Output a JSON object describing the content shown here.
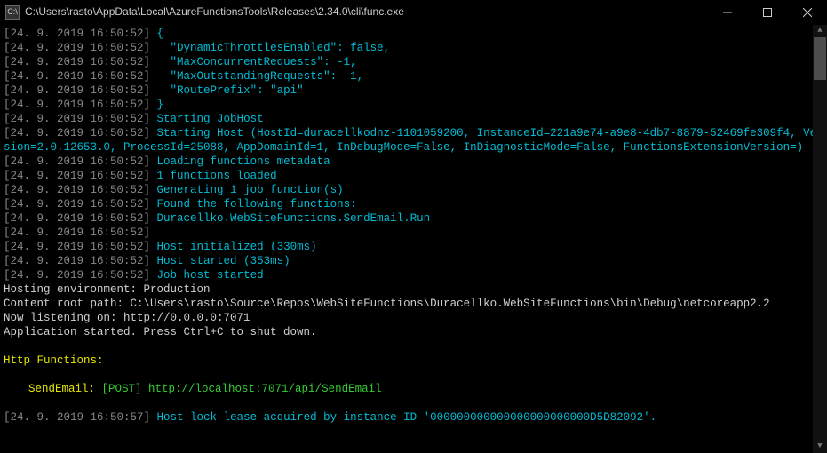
{
  "window": {
    "title": "C:\\Users\\rasto\\AppData\\Local\\AzureFunctionsTools\\Releases\\2.34.0\\cli\\func.exe",
    "icon_text": "C:\\"
  },
  "timestamps": {
    "t1": "[24. 9. 2019 16:50:52]",
    "t2": "[24. 9. 2019 16:50:57]"
  },
  "json_lines": {
    "l0": "{",
    "l1": "  \"DynamicThrottlesEnabled\": false,",
    "l2": "  \"MaxConcurrentRequests\": -1,",
    "l3": "  \"MaxOutstandingRequests\": -1,",
    "l4": "  \"RoutePrefix\": \"api\"",
    "l5": "}"
  },
  "msgs": {
    "starting_jobhost": "Starting JobHost",
    "starting_host": "Starting Host (HostId=duracellkodnz-1101059200, InstanceId=221a9e74-a9e8-4db7-8879-52469fe309f4, Version=2.0.12653.0, ProcessId=25088, AppDomainId=1, InDebugMode=False, InDiagnosticMode=False, FunctionsExtensionVersion=)",
    "loading_meta": "Loading functions metadata",
    "loaded": "1 functions loaded",
    "generating": "Generating 1 job function(s)",
    "found": "Found the following functions:",
    "function_name": "Duracellko.WebSiteFunctions.SendEmail.Run",
    "blank": "",
    "initialized": "Host initialized (330ms)",
    "started": "Host started (353ms)",
    "jobhost_started": "Job host started",
    "lock": "Host lock lease acquired by instance ID '000000000000000000000000D5D82092'."
  },
  "env": {
    "hosting": "Hosting environment: Production",
    "root": "Content root path: C:\\Users\\rasto\\Source\\Repos\\WebSiteFunctions\\Duracellko.WebSiteFunctions\\bin\\Debug\\netcoreapp2.2",
    "listening": "Now listening on: http://0.0.0.0:7071",
    "app_started": "Application started. Press Ctrl+C to shut down."
  },
  "http": {
    "header": "Http Functions:",
    "fn_label": "SendEmail: ",
    "method": "[POST] ",
    "url": "http://localhost:7071/api/SendEmail"
  }
}
